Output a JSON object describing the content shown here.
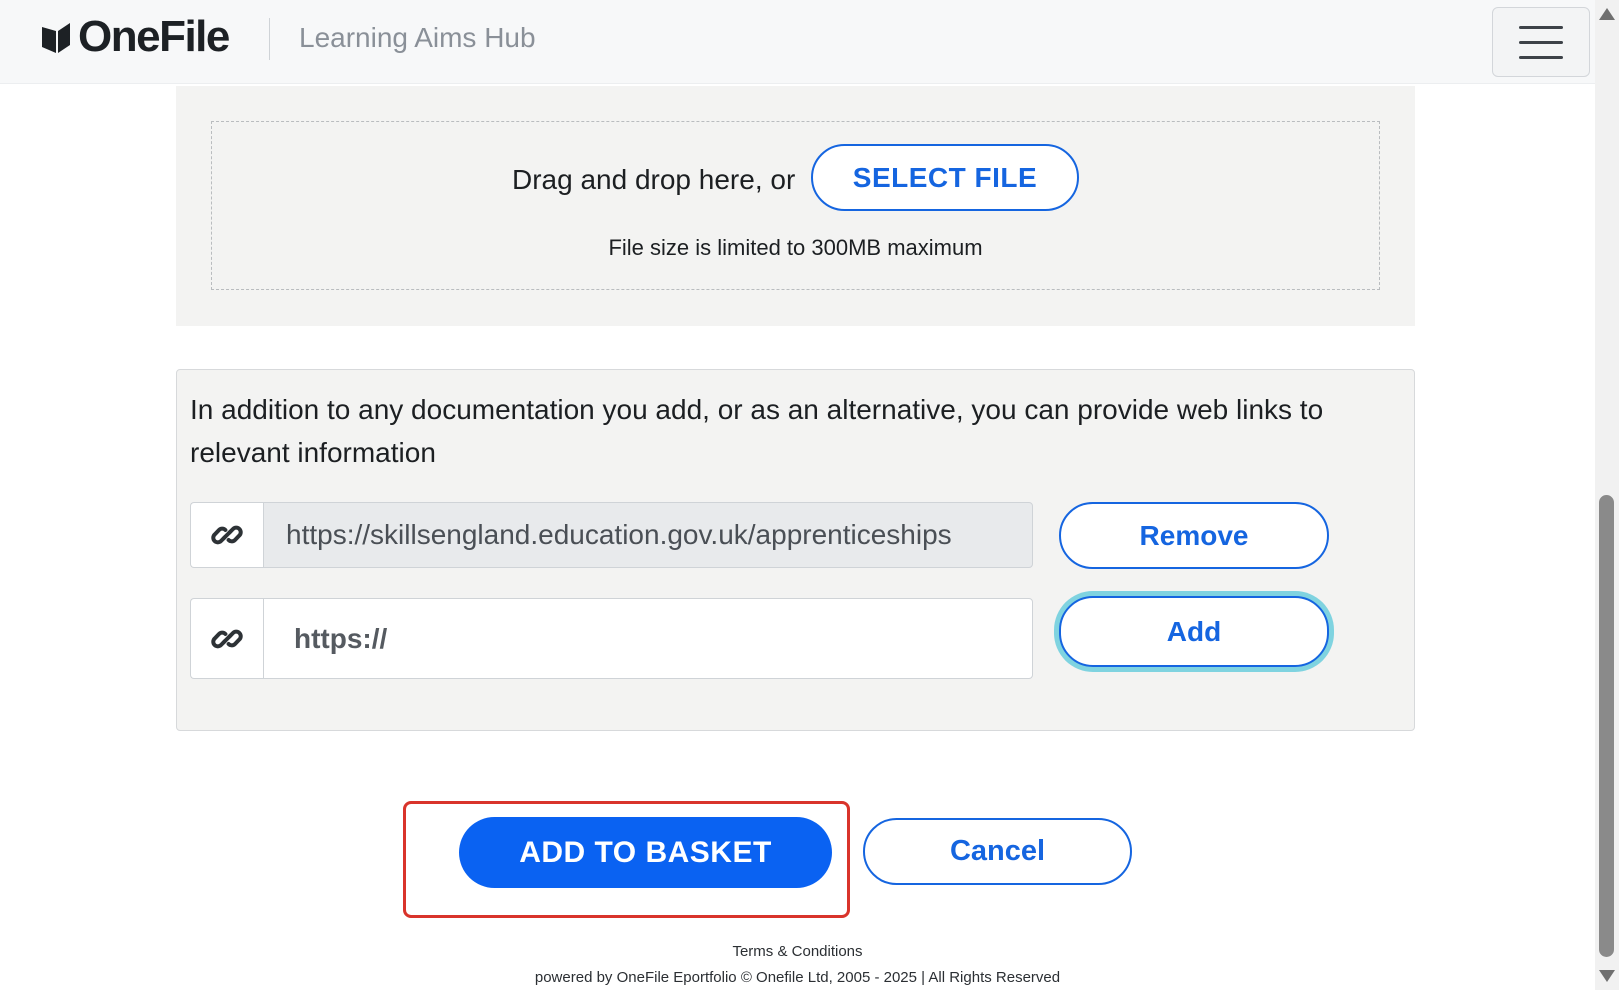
{
  "header": {
    "logo_text": "OneFile",
    "hub_title": "Learning Aims Hub",
    "menu_icon": "hamburger-icon"
  },
  "upload": {
    "drag_text": "Drag and drop here, or",
    "select_file_label": "SELECT FILE",
    "size_note": "File size is limited to 300MB maximum"
  },
  "links": {
    "intro": "In addition to any documentation you add, or as an alternative, you can provide web links to relevant information",
    "link_icon": "link-icon",
    "existing_url": "https://skillsengland.education.gov.uk/apprenticeships",
    "remove_label": "Remove",
    "new_url_placeholder": "https://",
    "add_label": "Add"
  },
  "actions": {
    "add_to_basket_label": "ADD TO BASKET",
    "cancel_label": "Cancel"
  },
  "footer": {
    "terms": "Terms & Conditions",
    "copyright": "powered by OneFile Eportfolio © Onefile Ltd, 2005 - 2025 | All Rights Reserved"
  },
  "colors": {
    "primary": "#0a62f2",
    "highlight": "#d9342b",
    "focus_ring": "#7fd3e0",
    "panel_bg": "#f3f3f2"
  }
}
